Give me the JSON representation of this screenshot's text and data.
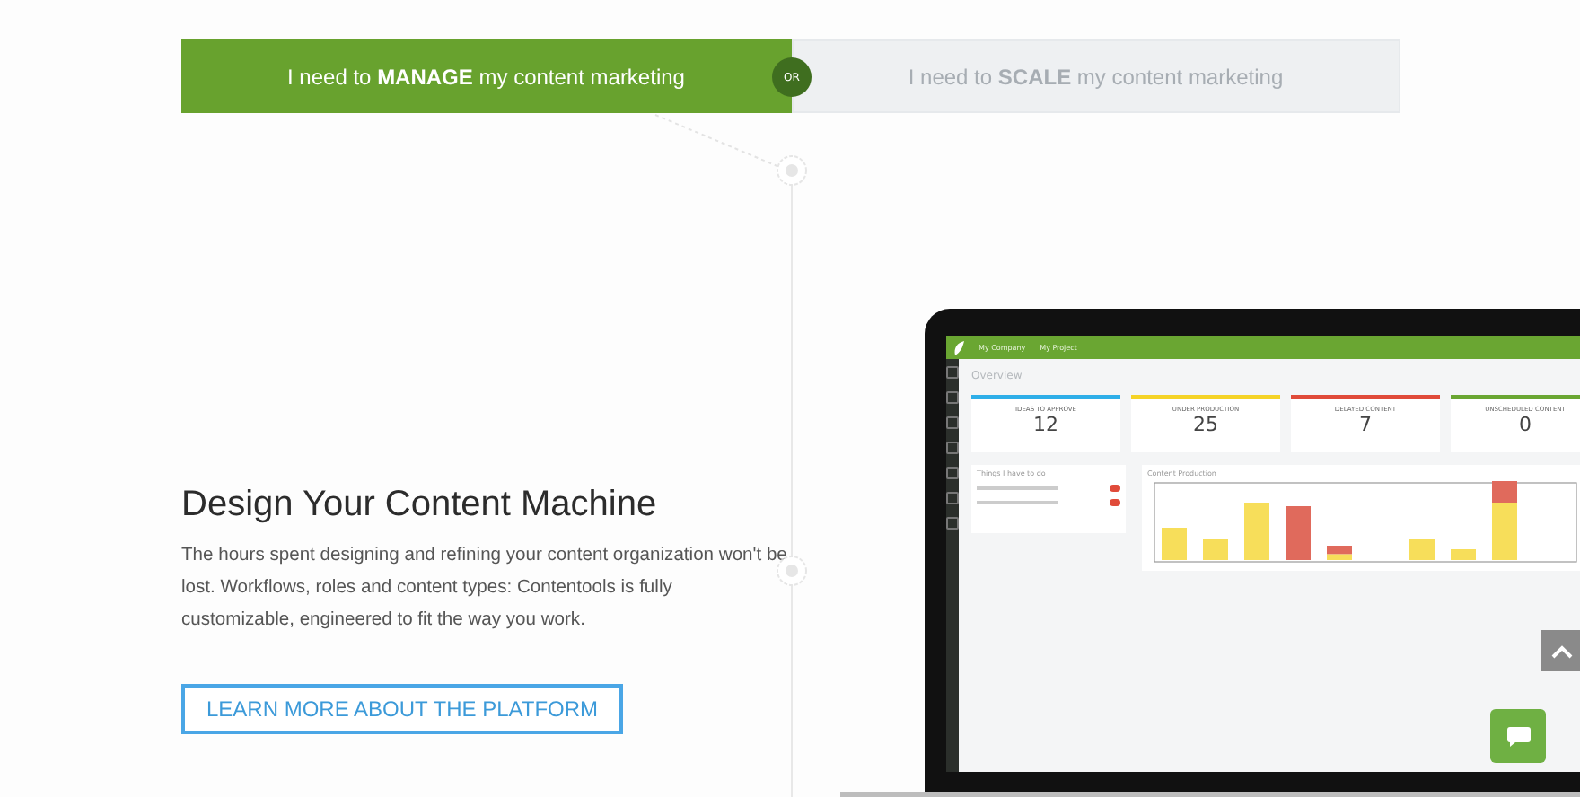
{
  "toggle": {
    "separator": "OR",
    "options": [
      {
        "text": "I need to **MANAGE** my content marketing",
        "selected": true
      },
      {
        "text": "I need to **SCALE** my content marketing",
        "selected": false
      }
    ]
  },
  "feature": {
    "title": "Design Your Content Machine",
    "body": "The hours spent designing and refining your content organization won't be lost. Workflows, roles and content types: Contentools is fully customizable, engineered to fit the way you work.",
    "button": "LEARN MORE ABOUT THE PLATFORM"
  },
  "dashboard": {
    "breadcrumbs": [
      "My Company",
      "My Project"
    ],
    "page_title": "Overview",
    "stats": [
      {
        "label": "IDEAS TO APPROVE",
        "value": "12",
        "color": "#2eaee8"
      },
      {
        "label": "UNDER PRODUCTION",
        "value": "25",
        "color": "#f5d327"
      },
      {
        "label": "DELAYED CONTENT",
        "value": "7",
        "color": "#e04b3a"
      },
      {
        "label": "UNSCHEDULED CONTENT",
        "value": "0",
        "color": "#6aa632"
      }
    ],
    "todo_title": "Things I have to do",
    "chart_title": "Content Production"
  }
}
